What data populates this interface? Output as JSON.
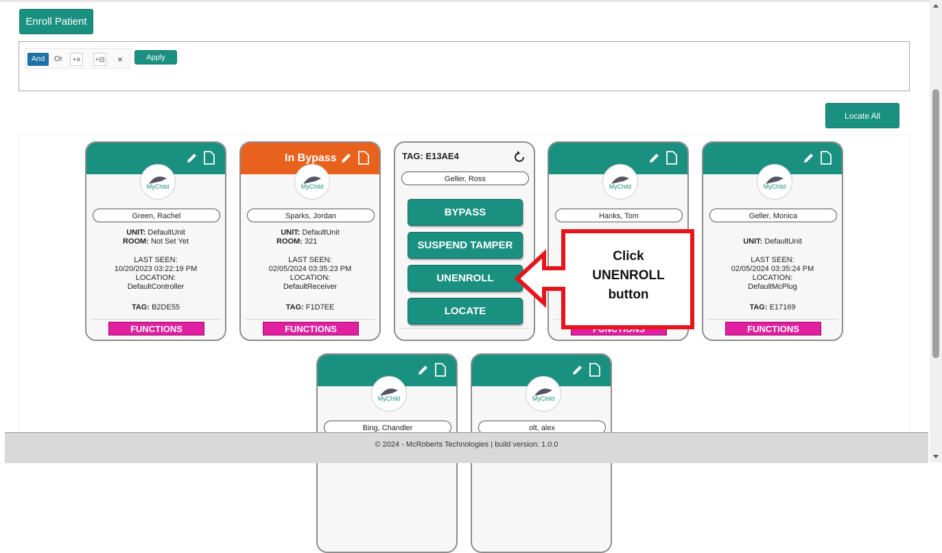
{
  "toolbar": {
    "enroll_label": "Enroll Patient",
    "locate_all_label": "Locate All"
  },
  "query": {
    "and_label": "And",
    "or_label": "Or",
    "clear_label": "×",
    "apply_label": "Apply"
  },
  "card_labels": {
    "unit": "UNIT:",
    "room": "ROOM:",
    "last_seen": "LAST SEEN:",
    "location": "LOCATION:",
    "tag": "TAG:",
    "functions": "FUNCTIONS"
  },
  "cards": [
    {
      "name": "Green, Rachel",
      "unit": "DefaultUnit",
      "room": "Not Set Yet",
      "last_seen": "10/20/2023 03:22:19 PM",
      "location": "DefaultController",
      "tag": "B2DE55"
    },
    {
      "status": "In Bypass",
      "name": "Sparks, Jordan",
      "unit": "DefaultUnit",
      "room": "321",
      "last_seen": "02/05/2024 03:35:23 PM",
      "location": "DefaultReceiver",
      "tag": "F1D7EE"
    },
    {
      "name": "Hanks, Tom"
    },
    {
      "name": "Geller, Monica",
      "unit": "DefaultUnit",
      "last_seen": "02/05/2024 03:35:24 PM",
      "location": "DefaultMcPlug",
      "tag": "E17169"
    },
    {
      "name": "Bing, Chandler"
    },
    {
      "name": "olt, alex"
    }
  ],
  "functions_card": {
    "tag_title": "TAG: E13AE4",
    "name": "Geller, Ross",
    "buttons": [
      "BYPASS",
      "SUSPEND TAMPER",
      "UNENROLL",
      "LOCATE"
    ]
  },
  "callout": {
    "line1": "Click",
    "line2": "UNENROLL",
    "line3": "button",
    "color": "#e8141b"
  },
  "logo_text": "MyChild",
  "footer": {
    "text": "© 2024 - McRoberts Technologies | build version: 1.0.0"
  },
  "colors": {
    "teal": "#1a9080",
    "bypass_orange": "#e8611d",
    "functions_pink": "#e020a0"
  }
}
